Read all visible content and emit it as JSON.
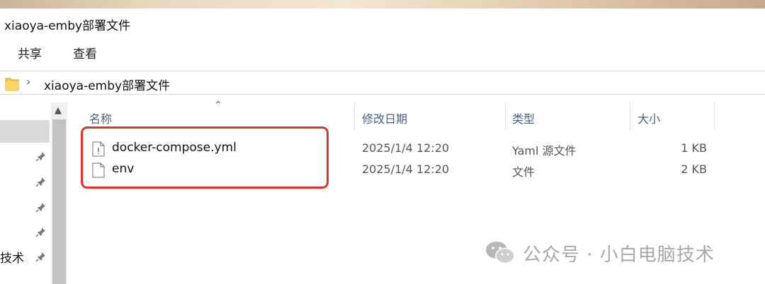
{
  "window": {
    "title": "xiaoya-emby部署文件"
  },
  "ribbon": {
    "tabs": [
      {
        "label": "共享"
      },
      {
        "label": "查看"
      }
    ]
  },
  "address": {
    "path": "xiaoya-emby部署文件"
  },
  "nav": {
    "partial_label": "技术"
  },
  "columns": {
    "name": "名称",
    "modified": "修改日期",
    "type": "类型",
    "size": "大小"
  },
  "files": [
    {
      "name": "docker-compose.yml",
      "modified": "2025/1/4 12:20",
      "type": "Yaml 源文件",
      "size": "1 KB"
    },
    {
      "name": "env",
      "modified": "2025/1/4 12:20",
      "type": "文件",
      "size": "2 KB"
    }
  ],
  "watermark": {
    "text": "公众号 · 小白电脑技术"
  },
  "colors": {
    "highlight": "#e0342a",
    "header_text": "#4d6082",
    "folder": "#f2c443"
  },
  "icons": {
    "folder": "folder-icon",
    "pin": "pin-icon",
    "file": "file-icon",
    "wechat": "wechat-icon"
  }
}
